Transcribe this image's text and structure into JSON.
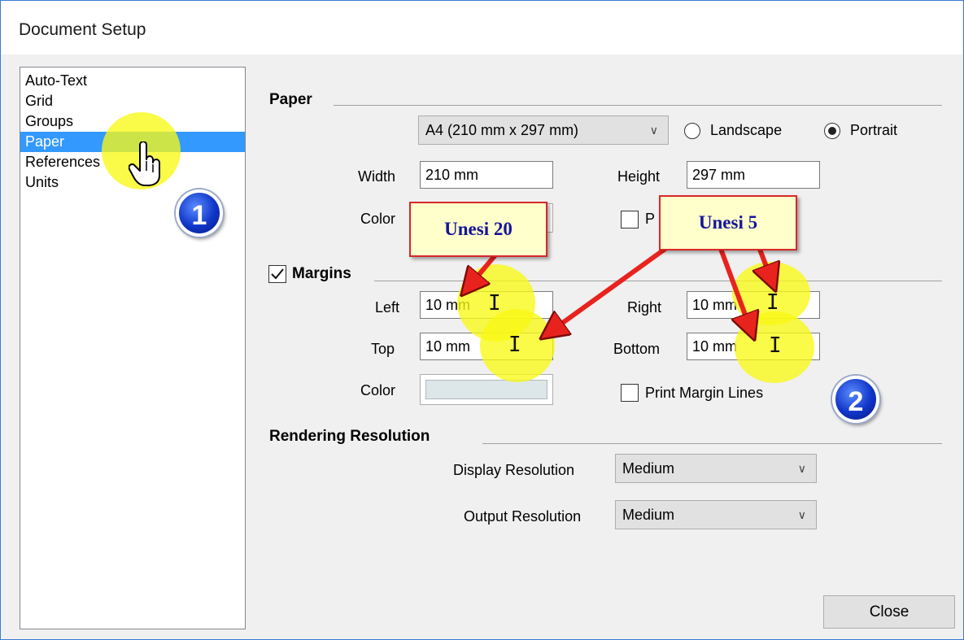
{
  "window": {
    "title": "Document Setup"
  },
  "nav": {
    "items": [
      {
        "label": "Auto-Text"
      },
      {
        "label": "Grid"
      },
      {
        "label": "Groups"
      },
      {
        "label": "Paper",
        "selected": true
      },
      {
        "label": "References"
      },
      {
        "label": "Units"
      }
    ]
  },
  "paper": {
    "heading": "Paper",
    "size_value": "A4 (210 mm x 297 mm)",
    "landscape_label": "Landscape",
    "portrait_label": "Portrait",
    "orientation": "Portrait",
    "width_label": "Width",
    "width_value": "210 mm",
    "height_label": "Height",
    "height_value": "297 mm",
    "color_label": "Color",
    "print_checkbox_label_partial": "P"
  },
  "margins": {
    "heading": "Margins",
    "enabled": true,
    "left_label": "Left",
    "left_value": "10 mm",
    "right_label": "Right",
    "right_value": "10 mm",
    "top_label": "Top",
    "top_value": "10 mm",
    "bottom_label": "Bottom",
    "bottom_value": "10 mm",
    "color_label": "Color",
    "color_value": "#dde7ea",
    "print_lines_label": "Print Margin Lines"
  },
  "rendering": {
    "heading": "Rendering Resolution",
    "display_label": "Display Resolution",
    "display_value": "Medium",
    "output_label": "Output Resolution",
    "output_value": "Medium"
  },
  "buttons": {
    "close_label": "Close"
  },
  "annotations": {
    "callout_left": "Unesi 20",
    "callout_right": "Unesi 5",
    "badge_1": "1",
    "badge_2": "2",
    "highlight_color": "#f8f814",
    "arrow_color": "#e8231e"
  }
}
